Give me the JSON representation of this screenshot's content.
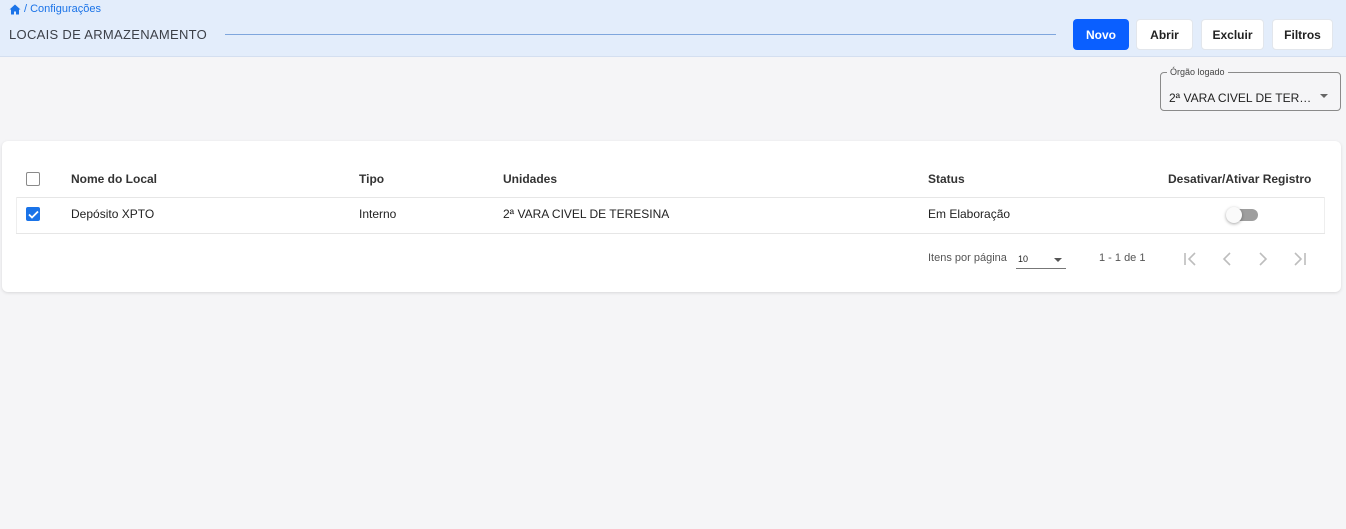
{
  "breadcrumb": {
    "home_icon": "home-icon",
    "separator": "/",
    "current": "Configurações"
  },
  "header": {
    "title": "LOCAIS DE ARMAZENAMENTO"
  },
  "toolbar": {
    "buttons": [
      {
        "label": "Novo",
        "variant": "primary"
      },
      {
        "label": "Abrir",
        "variant": "light"
      },
      {
        "label": "Excluir",
        "variant": "light"
      },
      {
        "label": "Filtros",
        "variant": "light"
      }
    ]
  },
  "orgao_select": {
    "label": "Órgão logado",
    "value": "2ª VARA CIVEL DE TERESINA"
  },
  "table": {
    "columns": [
      "Nome do Local",
      "Tipo",
      "Unidades",
      "Status",
      "Desativar/Ativar Registro"
    ],
    "rows": [
      {
        "selected": true,
        "nome": "Depósito XPTO",
        "tipo": "Interno",
        "unidades": "2ª VARA CIVEL DE TERESINA",
        "status": "Em Elaboração",
        "ativo": false
      }
    ]
  },
  "pagination": {
    "items_label": "Itens por página",
    "page_size": "10",
    "range": "1 - 1 de 1",
    "icons": [
      "first-page-icon",
      "previous-page-icon",
      "next-page-icon",
      "last-page-icon"
    ]
  },
  "colors": {
    "primary": "#0a5fff",
    "header_bg": "#e3edfb",
    "link": "#1a73e8",
    "checkbox": "#1a73e8"
  }
}
